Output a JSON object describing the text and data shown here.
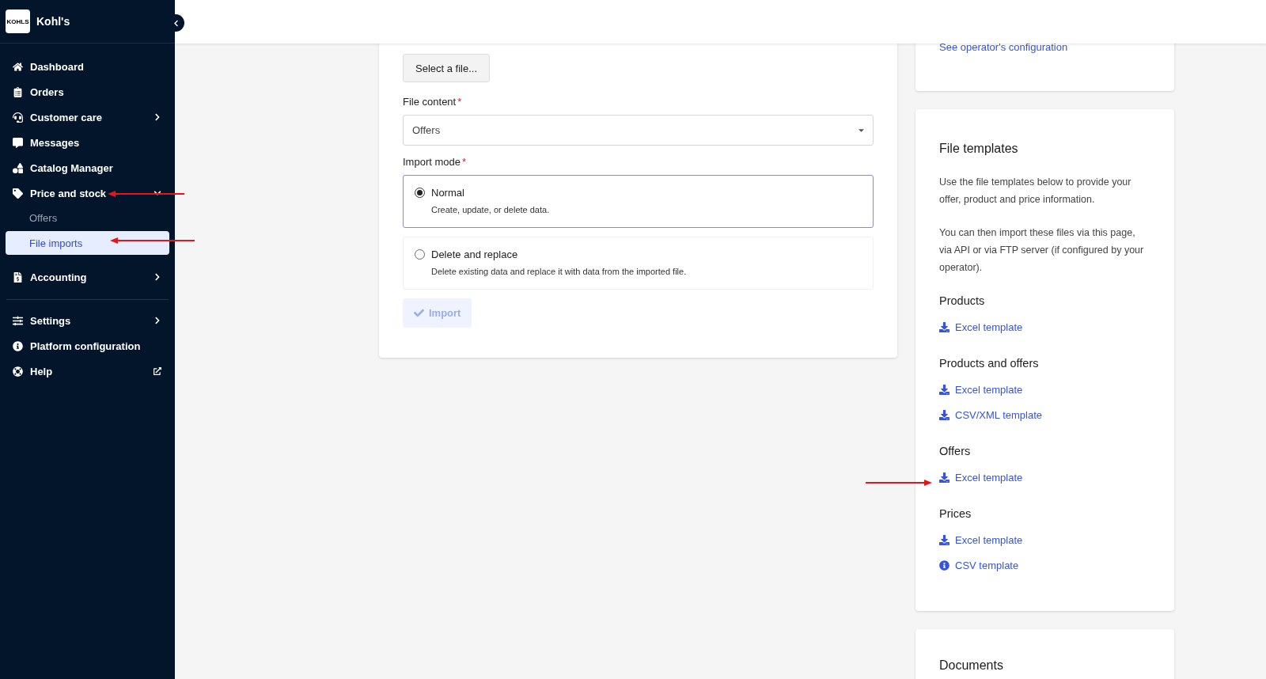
{
  "sidebar": {
    "brand": {
      "logo_text": "KOHLS",
      "name": "Kohl's"
    },
    "nav_groups": [
      {
        "items": [
          {
            "label": "Dashboard",
            "kind": "link"
          },
          {
            "label": "Orders",
            "kind": "link"
          },
          {
            "label": "Customer care",
            "kind": "group",
            "expanded": false
          },
          {
            "label": "Messages",
            "kind": "link"
          },
          {
            "label": "Catalog Manager",
            "kind": "link"
          },
          {
            "label": "Price and stock",
            "kind": "group",
            "expanded": true,
            "children": [
              {
                "label": "Offers",
                "selected": false
              },
              {
                "label": "File imports",
                "selected": true
              }
            ]
          },
          {
            "label": "Accounting",
            "kind": "group",
            "expanded": false
          }
        ]
      },
      {
        "items": [
          {
            "label": "Settings",
            "kind": "group",
            "expanded": false
          },
          {
            "label": "Platform configuration",
            "kind": "link"
          },
          {
            "label": "Help",
            "kind": "external"
          }
        ]
      }
    ]
  },
  "import_form": {
    "file_button": "Select a file...",
    "file_content": {
      "label": "File content",
      "required_mark": "*",
      "value": "Offers"
    },
    "import_mode": {
      "label": "Import mode",
      "required_mark": "*",
      "options": [
        {
          "label": "Normal",
          "description": "Create, update, or delete data.",
          "selected": true
        },
        {
          "label": "Delete and replace",
          "description": "Delete existing data and replace it with data from the imported file.",
          "selected": false
        }
      ]
    },
    "submit": {
      "label": "Import",
      "disabled": true
    }
  },
  "operator_card": {
    "link": "See operator's configuration"
  },
  "templates": {
    "title": "File templates",
    "paragraphs": [
      "Use the file templates below to provide your offer, product and price information.",
      "You can then import these files via this page, via API or via FTP server (if configured by your operator)."
    ],
    "groups": [
      {
        "title": "Products",
        "links": [
          {
            "label": "Excel template",
            "kind": "download"
          }
        ]
      },
      {
        "title": "Products and offers",
        "links": [
          {
            "label": "Excel template",
            "kind": "download"
          },
          {
            "label": "CSV/XML template",
            "kind": "download"
          }
        ]
      },
      {
        "title": "Offers",
        "links": [
          {
            "label": "Excel template",
            "kind": "download"
          }
        ]
      },
      {
        "title": "Prices",
        "links": [
          {
            "label": "Excel template",
            "kind": "download"
          },
          {
            "label": "CSV template",
            "kind": "info"
          }
        ]
      }
    ]
  },
  "documents": {
    "title": "Documents"
  }
}
